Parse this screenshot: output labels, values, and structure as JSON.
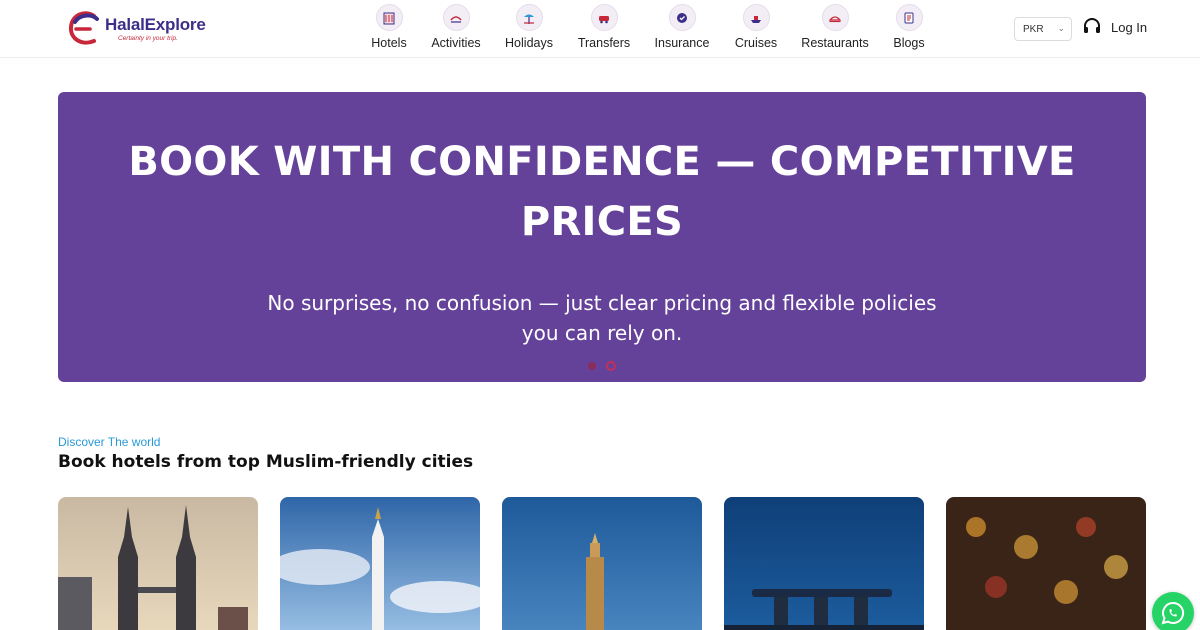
{
  "brand": {
    "name": "HalalExplore",
    "tagline": "Certainty in your trip."
  },
  "nav": {
    "items": [
      {
        "label": "Hotels",
        "icon": "hotel-icon"
      },
      {
        "label": "Activities",
        "icon": "activities-icon"
      },
      {
        "label": "Holidays",
        "icon": "holidays-icon"
      },
      {
        "label": "Transfers",
        "icon": "transfers-icon"
      },
      {
        "label": "Insurance",
        "icon": "insurance-icon"
      },
      {
        "label": "Cruises",
        "icon": "cruises-icon"
      },
      {
        "label": "Restaurants",
        "icon": "restaurants-icon"
      },
      {
        "label": "Blogs",
        "icon": "blogs-icon"
      }
    ]
  },
  "header": {
    "currency": "PKR",
    "login_label": "Log In"
  },
  "hero": {
    "title": "BOOK WITH CONFIDENCE — COMPETITIVE PRICES",
    "subtitle": "No surprises, no confusion — just clear pricing and flexible policies you can rely on.",
    "slide_count": 2,
    "active_slide": 2
  },
  "section": {
    "eyebrow": "Discover The world",
    "title": "Book hotels from top Muslim-friendly cities"
  },
  "colors": {
    "hero_bg": "#64429a",
    "brand_purple": "#3c2f8a",
    "brand_red": "#c6283a",
    "eyebrow_blue": "#2a9ad6",
    "whatsapp_green": "#25d366"
  }
}
